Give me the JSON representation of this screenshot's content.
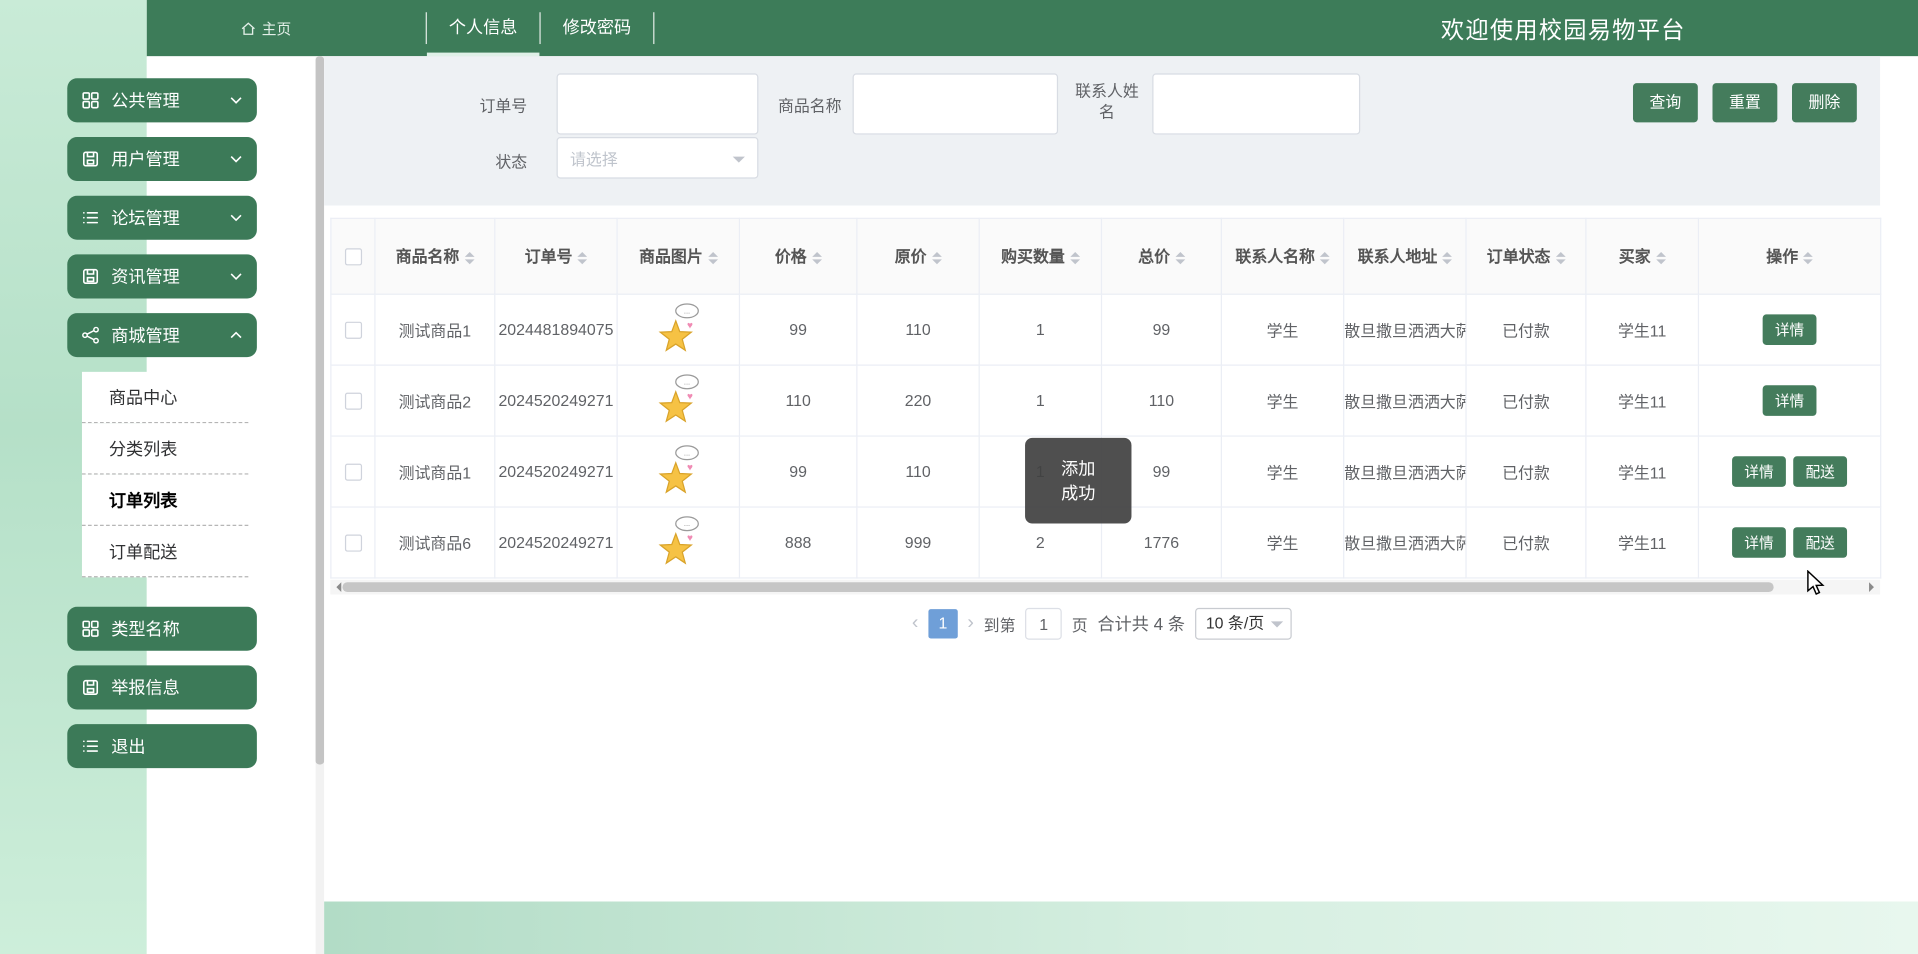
{
  "colors": {
    "topbar_green": "#3d7c59",
    "button_green": "#447c5c",
    "mint_strip": "#b5e0c8",
    "pagination_active_blue": "#6f9fd8"
  },
  "topbar": {
    "home_label": "主页",
    "tabs": [
      {
        "label": "个人信息",
        "active": true
      },
      {
        "label": "修改密码",
        "active": false
      }
    ],
    "welcome": "欢迎使用校园易物平台"
  },
  "sidebar": {
    "groups": [
      {
        "label": "公共管理",
        "icon": "grid-icon",
        "chevron": "down"
      },
      {
        "label": "用户管理",
        "icon": "save-icon",
        "chevron": "down"
      },
      {
        "label": "论坛管理",
        "icon": "list-icon",
        "chevron": "down"
      },
      {
        "label": "资讯管理",
        "icon": "save-icon",
        "chevron": "down"
      },
      {
        "label": "商城管理",
        "icon": "share-icon",
        "chevron": "up"
      },
      {
        "label": "类型名称",
        "icon": "grid-icon",
        "chevron": ""
      },
      {
        "label": "举报信息",
        "icon": "save-icon",
        "chevron": ""
      },
      {
        "label": "退出",
        "icon": "list-icon",
        "chevron": ""
      }
    ],
    "submenu": [
      {
        "label": "商品中心",
        "active": false
      },
      {
        "label": "分类列表",
        "active": false
      },
      {
        "label": "订单列表",
        "active": true
      },
      {
        "label": "订单配送",
        "active": false
      }
    ]
  },
  "search": {
    "order_no_label": "订单号",
    "order_no_value": "",
    "product_name_label": "商品名称",
    "product_name_value": "",
    "contact_name_label": "联系人姓名",
    "contact_name_value": "",
    "status_label": "状态",
    "status_placeholder": "请选择",
    "query_button": "查询",
    "reset_button": "重置",
    "delete_button": "删除"
  },
  "table": {
    "columns": [
      "商品名称",
      "订单号",
      "商品图片",
      "价格",
      "原价",
      "购买数量",
      "总价",
      "联系人名称",
      "联系人地址",
      "订单状态",
      "买家",
      "操作"
    ],
    "rows": [
      {
        "product": "测试商品1",
        "order_no": "2024481894075",
        "price": "99",
        "original_price": "110",
        "quantity": "1",
        "total": "99",
        "contact": "学生",
        "address": "散旦撒旦洒洒大萨",
        "status": "已付款",
        "buyer": "学生11",
        "actions": [
          "详情"
        ]
      },
      {
        "product": "测试商品2",
        "order_no": "2024520249271",
        "price": "110",
        "original_price": "220",
        "quantity": "1",
        "total": "110",
        "contact": "学生",
        "address": "散旦撒旦洒洒大萨",
        "status": "已付款",
        "buyer": "学生11",
        "actions": [
          "详情"
        ]
      },
      {
        "product": "测试商品1",
        "order_no": "2024520249271",
        "price": "99",
        "original_price": "110",
        "quantity": "1",
        "total": "99",
        "contact": "学生",
        "address": "散旦撒旦洒洒大萨",
        "status": "已付款",
        "buyer": "学生11",
        "actions": [
          "详情",
          "配送"
        ]
      },
      {
        "product": "测试商品6",
        "order_no": "2024520249271",
        "price": "888",
        "original_price": "999",
        "quantity": "2",
        "total": "1776",
        "contact": "学生",
        "address": "散旦撒旦洒洒大萨",
        "status": "已付款",
        "buyer": "学生11",
        "actions": [
          "详情",
          "配送"
        ]
      }
    ]
  },
  "pagination": {
    "current_page": "1",
    "goto_prefix": "到第",
    "goto_page_value": "1",
    "goto_suffix": "页",
    "total_text": "合计共 4 条",
    "page_size": "10 条/页"
  },
  "toast": {
    "message": "添加成功"
  }
}
